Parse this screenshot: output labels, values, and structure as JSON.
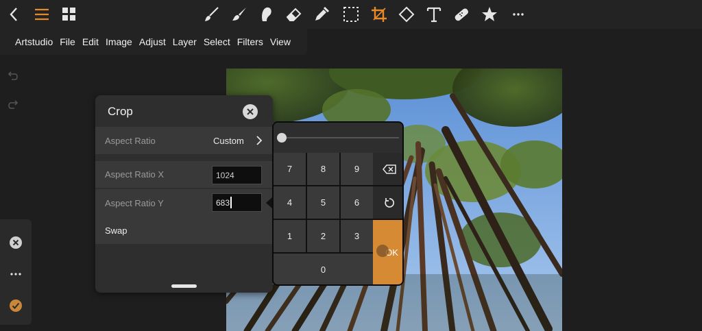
{
  "toolbar": {
    "icons": [
      "back-icon",
      "menu-icon",
      "grid-icon",
      "brush-icon",
      "paint-brush-icon",
      "smudge-icon",
      "eraser-icon",
      "eyedropper-icon",
      "selection-icon",
      "crop-icon",
      "shape-icon",
      "text-icon",
      "bandage-icon",
      "star-icon",
      "more-icon"
    ],
    "accent": "#e8892a"
  },
  "menu": {
    "items": [
      "Artstudio",
      "File",
      "Edit",
      "Image",
      "Adjust",
      "Layer",
      "Select",
      "Filters",
      "View"
    ]
  },
  "crop_panel": {
    "title": "Crop",
    "aspect_ratio_label": "Aspect Ratio",
    "aspect_ratio_value": "Custom",
    "aspect_x_label": "Aspect Ratio X",
    "aspect_x_value": "1024",
    "aspect_y_label": "Aspect Ratio Y",
    "aspect_y_value": "683",
    "swap_label": "Swap"
  },
  "keypad": {
    "keys": [
      "7",
      "8",
      "9",
      "4",
      "5",
      "6",
      "1",
      "2",
      "3",
      "0"
    ],
    "ok_label": "OK",
    "ok_color": "#d68a34"
  }
}
